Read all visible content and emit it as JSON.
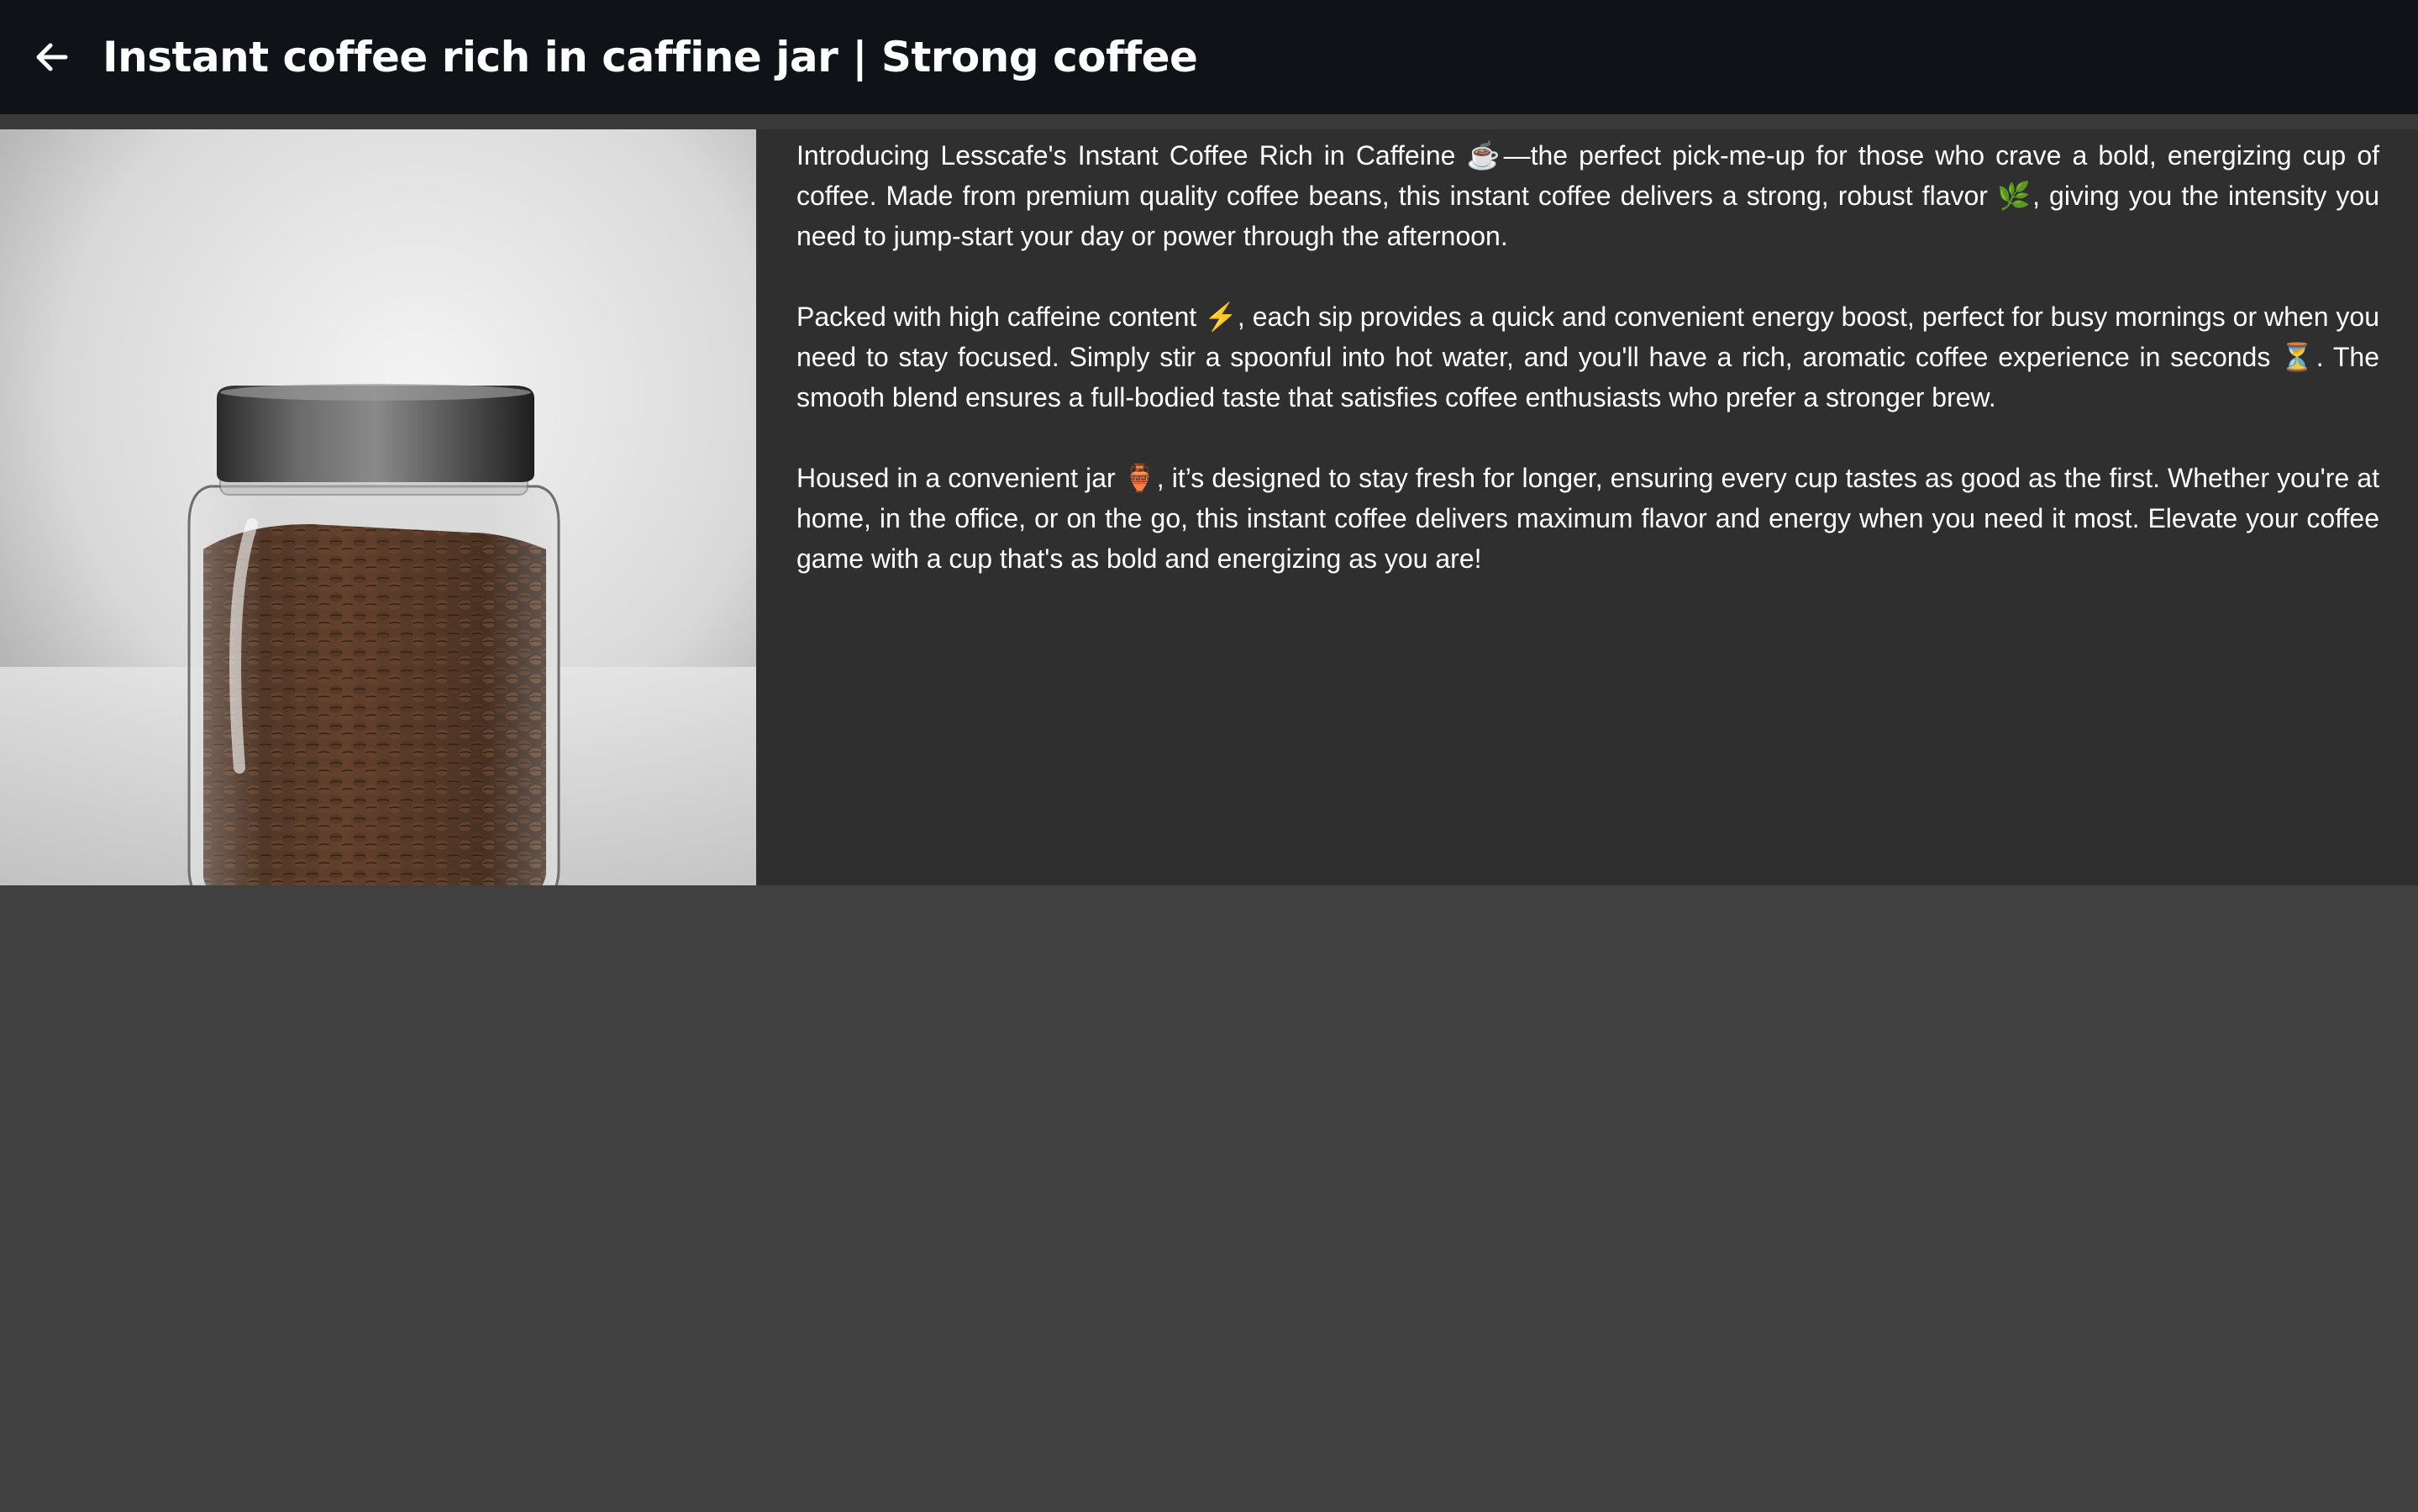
{
  "header": {
    "back_icon": "arrow-left-icon",
    "title": "Instant coffee rich in caffine jar | Strong coffee"
  },
  "product": {
    "image": {
      "icon": "coffee-jar-photo"
    },
    "description": [
      "Introducing Lesscafe's Instant Coffee Rich in Caffeine ☕—the perfect pick-me-up for those who crave a bold, energizing cup of coffee. Made from premium quality coffee beans, this instant coffee delivers a strong, robust flavor 🌿, giving you the intensity you need to jump-start your day or power through the afternoon.",
      "Packed with high caffeine content ⚡, each sip provides a quick and convenient energy boost, perfect for busy mornings or when you need to stay focused. Simply stir a spoonful into hot water, and you'll have a rich, aromatic coffee experience in seconds ⏳. The smooth blend ensures a full-bodied taste that satisfies coffee enthusiasts who prefer a stronger brew.",
      "Housed in a convenient jar 🏺, it’s designed to stay fresh for longer, ensuring every cup tastes as good as the first. Whether you're at home, in the office, or on the go, this instant coffee delivers maximum flavor and energy when you need it most. Elevate your coffee game with a cup that's as bold and energizing as you are!"
    ]
  },
  "colors": {
    "header_bg": "#0f1217",
    "content_bg": "#2f2f2f",
    "page_bg": "#404040",
    "text": "#ffffff"
  }
}
